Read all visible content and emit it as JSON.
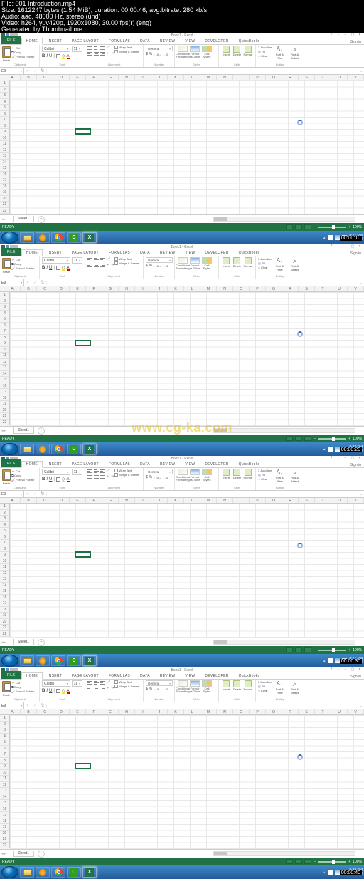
{
  "meta": {
    "line1": "File: 001 Introduction.mp4",
    "line2": "Size: 1612247 bytes (1.54 MiB), duration: 00:00:46, avg.bitrate: 280 kb/s",
    "line3": "Audio: aac, 48000 Hz, stereo (und)",
    "line4": "Video: h264, yuv420p, 1920x1080, 30.00 fps(r) (eng)",
    "line5": "Generated by Thumbnail me"
  },
  "watermark": "www.cg-ka.com",
  "excel": {
    "title": "Book1 - Excel",
    "signin": "Sign in",
    "namebox": "E9",
    "tabs": [
      "FILE",
      "HOME",
      "INSERT",
      "PAGE LAYOUT",
      "FORMULAS",
      "DATA",
      "REVIEW",
      "VIEW",
      "DEVELOPER",
      "QuickBooks"
    ],
    "clipboard": {
      "label": "Clipboard",
      "paste": "Paste",
      "cut": "Cut",
      "copy": "Copy",
      "painter": "Format Painter"
    },
    "font": {
      "label": "Font",
      "name": "Calibri",
      "size": "11"
    },
    "alignment": {
      "label": "Alignment",
      "wrap": "Wrap Text",
      "merge": "Merge & Center"
    },
    "number": {
      "label": "Number",
      "format": "General"
    },
    "styles": {
      "label": "Styles",
      "cond": "Conditional Formatting",
      "table": "Format as Table",
      "cell": "Cell Styles"
    },
    "cells": {
      "label": "Cells",
      "insert": "Insert",
      "delete": "Delete",
      "format": "Format"
    },
    "editing": {
      "label": "Editing",
      "sum": "AutoSum",
      "fill": "Fill",
      "clear": "Clear",
      "sort": "Sort & Filter",
      "find": "Find & Select"
    },
    "cols": [
      "A",
      "B",
      "C",
      "D",
      "E",
      "F",
      "G",
      "H",
      "I",
      "J",
      "K",
      "L",
      "M",
      "N",
      "O",
      "P",
      "Q",
      "R",
      "S",
      "T",
      "U",
      "V"
    ],
    "rows": 22,
    "sheet": "Sheet1",
    "status": "READY",
    "zoom": "100%"
  },
  "frames": [
    {
      "time": "8:27 PM",
      "date": "10/30/20",
      "timecode": "00:00:10"
    },
    {
      "time": "8:27 PM",
      "date": "10/30/20",
      "timecode": "00:00:20"
    },
    {
      "time": "8:27 PM",
      "date": "10/30/20",
      "timecode": "00:00:30"
    },
    {
      "time": "8:28 PM",
      "date": "10/30/20",
      "timecode": "00:00:40"
    }
  ]
}
